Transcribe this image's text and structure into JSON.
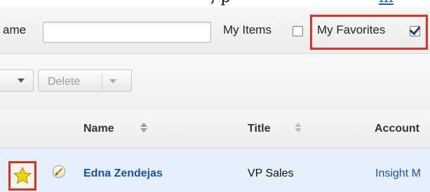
{
  "top": {
    "cut_text": "; p",
    "cut_link": "m"
  },
  "filter": {
    "name_label": "ame",
    "name_value": "",
    "my_items_label": "My Items",
    "my_items_checked": false,
    "my_favorites_label": "My Favorites",
    "my_favorites_checked": true
  },
  "actions": {
    "delete_label": "Delete"
  },
  "table": {
    "columns": [
      "Name",
      "Title",
      "Account"
    ],
    "rows": [
      {
        "favorite": true,
        "name": "Edna Zendejas",
        "title": "VP Sales",
        "account": "Insight M"
      }
    ]
  },
  "colors": {
    "highlight": "#e0301e",
    "link": "#1c4fb5",
    "row_bg": "#e6f0fb",
    "star": "#f2d20d"
  },
  "icons": [
    "checkbox-icon",
    "checkbox-checked-icon",
    "chevron-down-icon",
    "sort-icon",
    "star-icon",
    "pencil-icon"
  ]
}
